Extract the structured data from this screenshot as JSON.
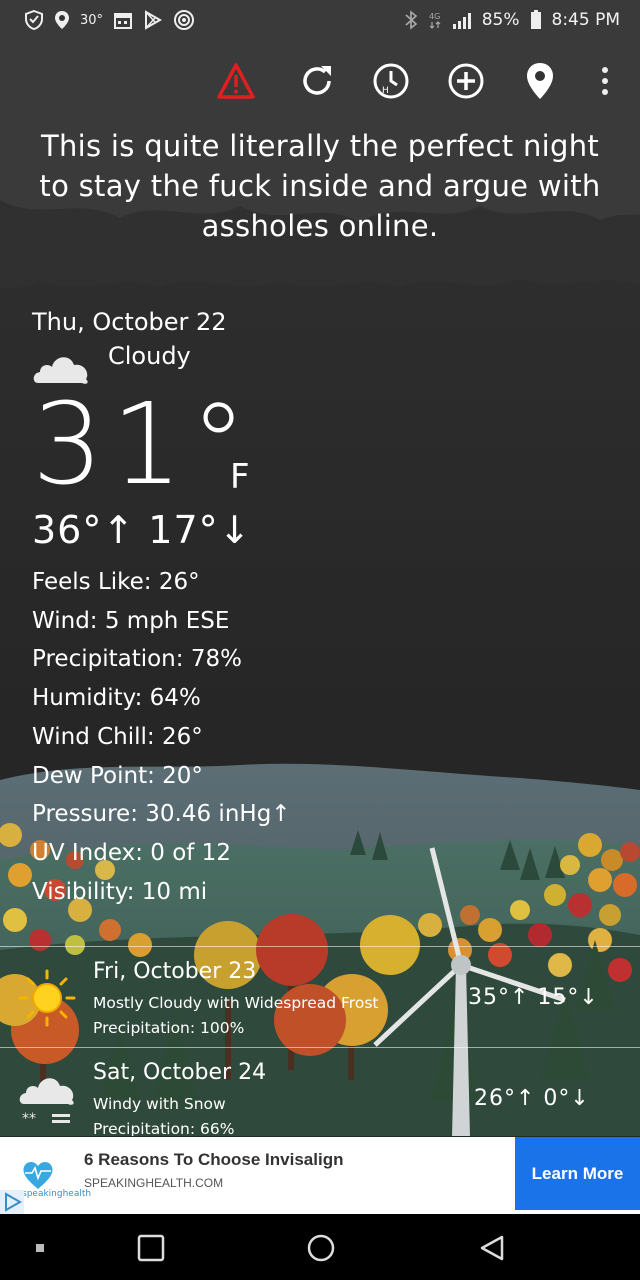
{
  "status_bar": {
    "temp_badge": "30°",
    "battery": "85%",
    "time": "8:45 PM",
    "icons_left": [
      "shield-icon",
      "location-pin-icon",
      "temp-badge",
      "calendar-icon",
      "play-store-icon",
      "target-icon"
    ],
    "icons_right": [
      "bluetooth-icon",
      "data-4g-icon",
      "signal-icon",
      "battery-icon"
    ]
  },
  "toolbar": {
    "icons": [
      "alert-icon",
      "refresh-icon",
      "history-icon",
      "add-location-icon",
      "location-icon",
      "more-vert-icon"
    ],
    "alert_color": "#e02020"
  },
  "quote": "This is quite literally the perfect night to stay the fuck inside and argue with assholes online.",
  "current": {
    "date": "Thu, October 22",
    "condition": "Cloudy",
    "condition_icon": "cloud-icon",
    "temperature": "31°",
    "unit": "F",
    "hilo": "36°↑ 17°↓",
    "details": [
      "Feels Like: 26°",
      "Wind: 5 mph ESE",
      "Precipitation: 78%",
      "Humidity: 64%",
      "Wind Chill: 26°",
      "Dew Point: 20°",
      "Pressure: 30.46 inHg↑",
      "UV Index: 0 of 12",
      "Visibility: 10 mi"
    ]
  },
  "forecast": [
    {
      "day": "Fri, October 23",
      "summary": "Mostly Cloudy with Widespread Frost",
      "precip": "Precipitation: 100%",
      "hilo": "35°↑ 15°↓",
      "icon": "sun-icon"
    },
    {
      "day": "Sat, October 24",
      "summary": "Windy with Snow",
      "precip": "Precipitation: 66%",
      "hilo": "26°↑ 0°↓",
      "icon": "snow-cloud-icon"
    }
  ],
  "ad": {
    "title": "6 Reasons To Choose Invisalign",
    "url": "SPEAKINGHEALTH.COM",
    "brand": "speakinghealth",
    "cta": "Learn More",
    "cta_color": "#1a73e8"
  },
  "nav": {
    "icons": [
      "dot-icon",
      "recents-icon",
      "home-icon",
      "back-icon"
    ]
  }
}
